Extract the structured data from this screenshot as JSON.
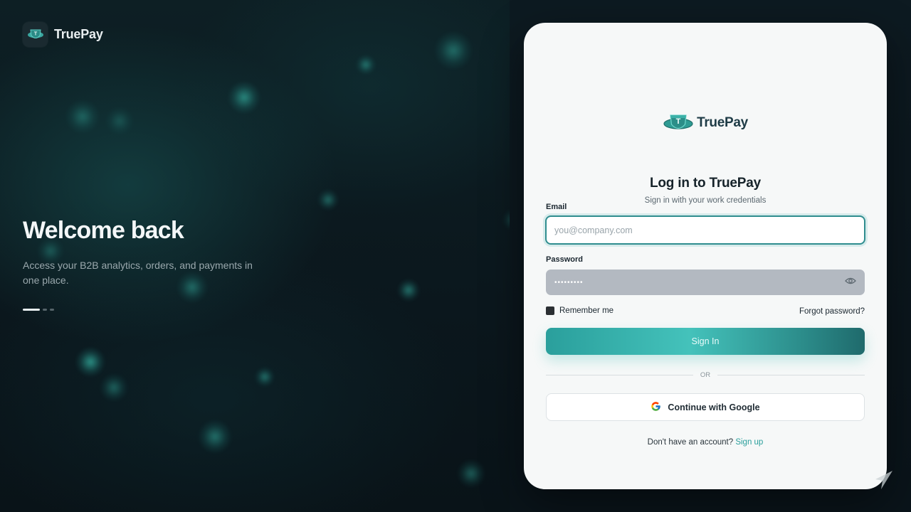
{
  "brand": {
    "name": "TruePay",
    "logo_icon": "shield-t-icon"
  },
  "hero": {
    "title": "Welcome back",
    "subtitle": "Access your B2B analytics, orders, and payments in one place.",
    "carousel": {
      "total": 3,
      "active": 1
    }
  },
  "login_card": {
    "logo_text": "TruePay",
    "title": "Log in to TruePay",
    "subtitle": "Sign in with your work credentials",
    "email": {
      "label": "Email",
      "placeholder": "you@company.com",
      "value": ""
    },
    "password": {
      "label": "Password",
      "value_masked": "•••••••••",
      "reveal_icon": "eye-icon"
    },
    "remember_me": {
      "label": "Remember me",
      "checked": true
    },
    "forgot_password": "Forgot password?",
    "sign_in_button": "Sign In",
    "divider_text": "OR",
    "google_button": "Continue with Google",
    "signup_prompt": "Don't have an account?",
    "signup_link": "Sign up"
  },
  "colors": {
    "accent": "#2a9f9c",
    "card_bg": "#f6f8f8",
    "page_bg": "#0b151b"
  }
}
